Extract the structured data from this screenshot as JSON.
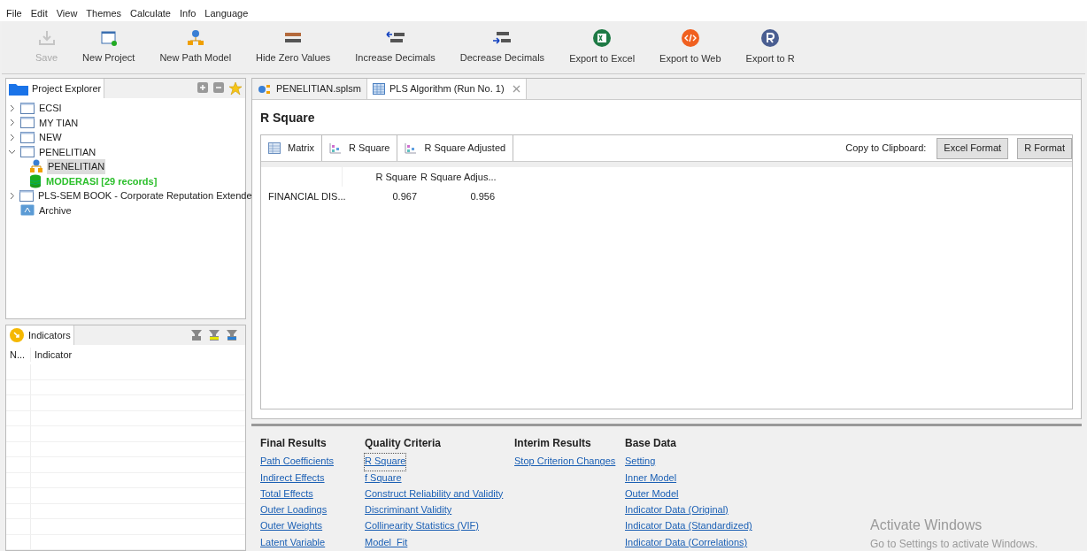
{
  "menu": [
    "File",
    "Edit",
    "View",
    "Themes",
    "Calculate",
    "Info",
    "Language"
  ],
  "toolbar": [
    {
      "kind": "save",
      "label": "Save",
      "disabled": true
    },
    {
      "kind": "project",
      "label": "New Project",
      "disabled": false
    },
    {
      "kind": "model",
      "label": "New Path Model",
      "disabled": false
    },
    {
      "kind": "zero",
      "label": "Hide Zero Values",
      "disabled": false
    },
    {
      "kind": "inc",
      "label": "Increase Decimals",
      "disabled": false
    },
    {
      "kind": "dec",
      "label": "Decrease Decimals",
      "disabled": false
    },
    {
      "kind": "excel",
      "label": "Export to Excel",
      "disabled": false
    },
    {
      "kind": "web",
      "label": "Export to Web",
      "disabled": false
    },
    {
      "kind": "r",
      "label": "Export to R",
      "disabled": false
    }
  ],
  "project_explorer": {
    "title": "Project Explorer",
    "tree": [
      {
        "kind": "project",
        "label": "ECSI",
        "expanded": false,
        "selected": false
      },
      {
        "kind": "project",
        "label": "MY TIAN",
        "expanded": false,
        "selected": false
      },
      {
        "kind": "project",
        "label": "NEW",
        "expanded": false,
        "selected": false
      },
      {
        "kind": "project",
        "label": "PENELITIAN",
        "expanded": true,
        "selected": false,
        "children": [
          {
            "kind": "model",
            "label": "PENELITIAN",
            "selected": true
          },
          {
            "kind": "dataset",
            "label": "MODERASI [29 records]",
            "selected": false
          }
        ]
      },
      {
        "kind": "project",
        "label": "PLS-SEM BOOK - Corporate Reputation Extende",
        "expanded": false,
        "selected": false
      },
      {
        "kind": "archive",
        "label": "Archive",
        "selected": false
      }
    ]
  },
  "indicators": {
    "title": "Indicators",
    "columns": [
      "N...",
      "Indicator"
    ]
  },
  "editor_tabs": [
    {
      "kind": "model",
      "label": "PENELITIAN.splsm",
      "selected": false
    },
    {
      "kind": "table",
      "label": "PLS Algorithm (Run No. 1)",
      "selected": true
    }
  ],
  "report": {
    "title": "R Square",
    "view_tabs": [
      {
        "kind": "matrix",
        "label": "Matrix"
      },
      {
        "kind": "chart",
        "label": "R Square"
      },
      {
        "kind": "chart",
        "label": "R Square Adjusted"
      }
    ],
    "clipboard_label": "Copy to Clipboard:",
    "clipboard_buttons": [
      "Excel Format",
      "R Format"
    ],
    "table": {
      "columns": [
        "R Square",
        "R Square Adjus..."
      ],
      "rows": [
        {
          "label": "FINANCIAL DIS...",
          "values": [
            "0.967",
            "0.956"
          ]
        }
      ]
    }
  },
  "navigation": [
    {
      "heading": "Final Results",
      "links": [
        {
          "label": "Path Coefficients",
          "selected": false
        },
        {
          "label": "Indirect Effects",
          "selected": false
        },
        {
          "label": "Total Effects",
          "selected": false
        },
        {
          "label": "Outer Loadings",
          "selected": false
        },
        {
          "label": "Outer Weights",
          "selected": false
        },
        {
          "label": "Latent Variable",
          "selected": false
        }
      ]
    },
    {
      "heading": "Quality Criteria",
      "links": [
        {
          "label": "R Square",
          "selected": true
        },
        {
          "label": "f Square",
          "selected": false
        },
        {
          "label": "Construct Reliability and Validity",
          "selected": false
        },
        {
          "label": "Discriminant Validity",
          "selected": false
        },
        {
          "label": "Collinearity Statistics (VIF)",
          "selected": false
        },
        {
          "label": "Model_Fit",
          "selected": false
        }
      ]
    },
    {
      "heading": "Interim Results",
      "links": [
        {
          "label": "Stop Criterion Changes",
          "selected": false
        }
      ]
    },
    {
      "heading": "Base Data",
      "links": [
        {
          "label": "Setting",
          "selected": false
        },
        {
          "label": "Inner Model",
          "selected": false
        },
        {
          "label": "Outer Model",
          "selected": false
        },
        {
          "label": "Indicator Data (Original)",
          "selected": false
        },
        {
          "label": "Indicator Data (Standardized)",
          "selected": false
        },
        {
          "label": "Indicator Data (Correlations)",
          "selected": false
        }
      ]
    }
  ],
  "os_notice": {
    "title": "Activate Windows",
    "subtitle": "Go to Settings to activate Windows."
  }
}
